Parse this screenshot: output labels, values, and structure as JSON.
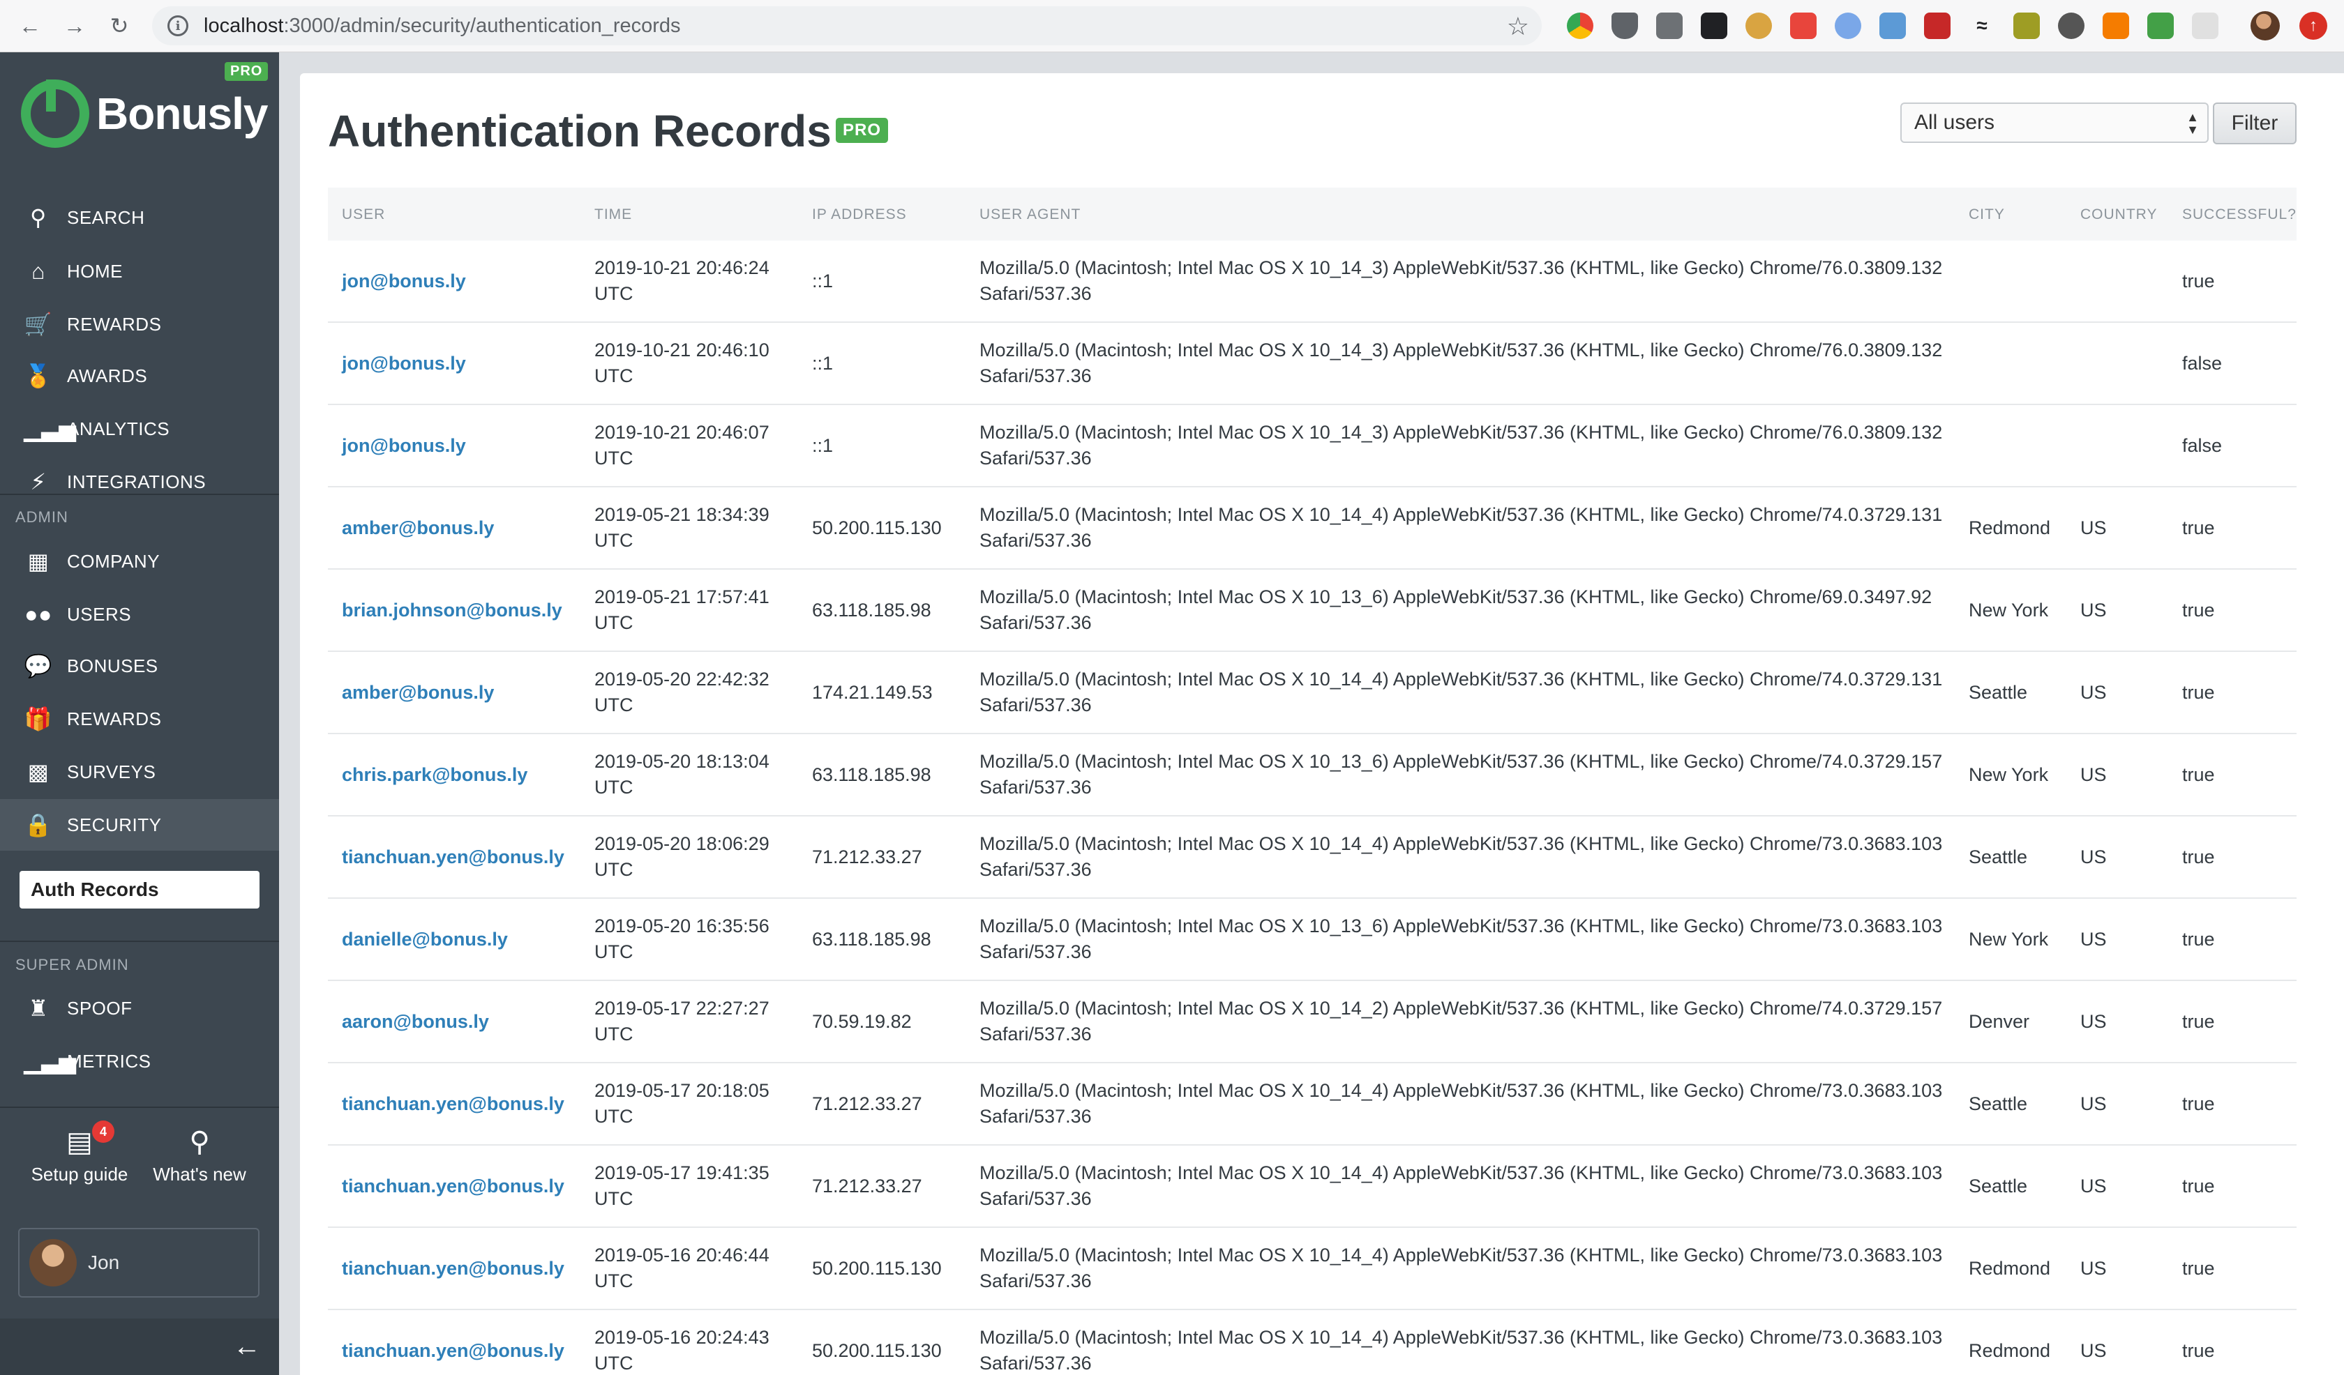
{
  "browser": {
    "url_host": "localhost",
    "url_path": ":3000/admin/security/authentication_records"
  },
  "sidebar": {
    "logo_text": "Bonusly",
    "pro_badge": "PRO",
    "nav": [
      {
        "label": "SEARCH",
        "icon": "search-icon"
      },
      {
        "label": "HOME",
        "icon": "home-icon"
      },
      {
        "label": "REWARDS",
        "icon": "cart-icon"
      },
      {
        "label": "AWARDS",
        "icon": "medal-icon"
      },
      {
        "label": "ANALYTICS",
        "icon": "bar-chart-icon"
      },
      {
        "label": "INTEGRATIONS",
        "icon": "plug-icon"
      }
    ],
    "admin_section": "ADMIN",
    "admin_nav": [
      {
        "label": "COMPANY",
        "icon": "building-icon"
      },
      {
        "label": "USERS",
        "icon": "users-icon"
      },
      {
        "label": "BONUSES",
        "icon": "chat-bubble-icon"
      },
      {
        "label": "REWARDS",
        "icon": "gift-icon"
      },
      {
        "label": "SURVEYS",
        "icon": "survey-chart-icon"
      },
      {
        "label": "SECURITY",
        "icon": "lock-icon"
      }
    ],
    "subnav_active": "Auth Records",
    "super_admin_section": "SUPER ADMIN",
    "super_admin_nav": [
      {
        "label": "SPOOF",
        "icon": "spy-icon"
      },
      {
        "label": "METRICS",
        "icon": "metrics-chart-icon"
      }
    ],
    "setup_guide": {
      "label": "Setup guide",
      "badge": "4"
    },
    "whats_new": {
      "label": "What's new"
    },
    "user_name": "Jon"
  },
  "main": {
    "title": "Authentication Records",
    "pro_badge": "PRO",
    "user_filter": "All users",
    "filter_button": "Filter",
    "columns": [
      "USER",
      "TIME",
      "IP ADDRESS",
      "USER AGENT",
      "CITY",
      "COUNTRY",
      "SUCCESSFUL?"
    ],
    "rows": [
      {
        "user": "jon@bonus.ly",
        "time1": "2019-10-21 20:46:24",
        "time2": "UTC",
        "ip": "::1",
        "ua1": "Mozilla/5.0 (Macintosh; Intel Mac OS X 10_14_3) AppleWebKit/537.36 (KHTML, like Gecko) Chrome/76.0.3809.132",
        "ua2": "Safari/537.36",
        "city": "",
        "country": "",
        "success": "true"
      },
      {
        "user": "jon@bonus.ly",
        "time1": "2019-10-21 20:46:10",
        "time2": "UTC",
        "ip": "::1",
        "ua1": "Mozilla/5.0 (Macintosh; Intel Mac OS X 10_14_3) AppleWebKit/537.36 (KHTML, like Gecko) Chrome/76.0.3809.132",
        "ua2": "Safari/537.36",
        "city": "",
        "country": "",
        "success": "false"
      },
      {
        "user": "jon@bonus.ly",
        "time1": "2019-10-21 20:46:07",
        "time2": "UTC",
        "ip": "::1",
        "ua1": "Mozilla/5.0 (Macintosh; Intel Mac OS X 10_14_3) AppleWebKit/537.36 (KHTML, like Gecko) Chrome/76.0.3809.132",
        "ua2": "Safari/537.36",
        "city": "",
        "country": "",
        "success": "false"
      },
      {
        "user": "amber@bonus.ly",
        "time1": "2019-05-21 18:34:39",
        "time2": "UTC",
        "ip": "50.200.115.130",
        "ua1": "Mozilla/5.0 (Macintosh; Intel Mac OS X 10_14_4) AppleWebKit/537.36 (KHTML, like Gecko) Chrome/74.0.3729.131",
        "ua2": "Safari/537.36",
        "city": "Redmond",
        "country": "US",
        "success": "true"
      },
      {
        "user": "brian.johnson@bonus.ly",
        "time1": "2019-05-21 17:57:41",
        "time2": "UTC",
        "ip": "63.118.185.98",
        "ua1": "Mozilla/5.0 (Macintosh; Intel Mac OS X 10_13_6) AppleWebKit/537.36 (KHTML, like Gecko) Chrome/69.0.3497.92",
        "ua2": "Safari/537.36",
        "city": "New York",
        "country": "US",
        "success": "true"
      },
      {
        "user": "amber@bonus.ly",
        "time1": "2019-05-20 22:42:32",
        "time2": "UTC",
        "ip": "174.21.149.53",
        "ua1": "Mozilla/5.0 (Macintosh; Intel Mac OS X 10_14_4) AppleWebKit/537.36 (KHTML, like Gecko) Chrome/74.0.3729.131",
        "ua2": "Safari/537.36",
        "city": "Seattle",
        "country": "US",
        "success": "true"
      },
      {
        "user": "chris.park@bonus.ly",
        "time1": "2019-05-20 18:13:04",
        "time2": "UTC",
        "ip": "63.118.185.98",
        "ua1": "Mozilla/5.0 (Macintosh; Intel Mac OS X 10_13_6) AppleWebKit/537.36 (KHTML, like Gecko) Chrome/74.0.3729.157",
        "ua2": "Safari/537.36",
        "city": "New York",
        "country": "US",
        "success": "true"
      },
      {
        "user": "tianchuan.yen@bonus.ly",
        "time1": "2019-05-20 18:06:29",
        "time2": "UTC",
        "ip": "71.212.33.27",
        "ua1": "Mozilla/5.0 (Macintosh; Intel Mac OS X 10_14_4) AppleWebKit/537.36 (KHTML, like Gecko) Chrome/73.0.3683.103",
        "ua2": "Safari/537.36",
        "city": "Seattle",
        "country": "US",
        "success": "true"
      },
      {
        "user": "danielle@bonus.ly",
        "time1": "2019-05-20 16:35:56",
        "time2": "UTC",
        "ip": "63.118.185.98",
        "ua1": "Mozilla/5.0 (Macintosh; Intel Mac OS X 10_13_6) AppleWebKit/537.36 (KHTML, like Gecko) Chrome/73.0.3683.103",
        "ua2": "Safari/537.36",
        "city": "New York",
        "country": "US",
        "success": "true"
      },
      {
        "user": "aaron@bonus.ly",
        "time1": "2019-05-17 22:27:27",
        "time2": "UTC",
        "ip": "70.59.19.82",
        "ua1": "Mozilla/5.0 (Macintosh; Intel Mac OS X 10_14_2) AppleWebKit/537.36 (KHTML, like Gecko) Chrome/74.0.3729.157",
        "ua2": "Safari/537.36",
        "city": "Denver",
        "country": "US",
        "success": "true"
      },
      {
        "user": "tianchuan.yen@bonus.ly",
        "time1": "2019-05-17 20:18:05",
        "time2": "UTC",
        "ip": "71.212.33.27",
        "ua1": "Mozilla/5.0 (Macintosh; Intel Mac OS X 10_14_4) AppleWebKit/537.36 (KHTML, like Gecko) Chrome/73.0.3683.103",
        "ua2": "Safari/537.36",
        "city": "Seattle",
        "country": "US",
        "success": "true"
      },
      {
        "user": "tianchuan.yen@bonus.ly",
        "time1": "2019-05-17 19:41:35",
        "time2": "UTC",
        "ip": "71.212.33.27",
        "ua1": "Mozilla/5.0 (Macintosh; Intel Mac OS X 10_14_4) AppleWebKit/537.36 (KHTML, like Gecko) Chrome/73.0.3683.103",
        "ua2": "Safari/537.36",
        "city": "Seattle",
        "country": "US",
        "success": "true"
      },
      {
        "user": "tianchuan.yen@bonus.ly",
        "time1": "2019-05-16 20:46:44",
        "time2": "UTC",
        "ip": "50.200.115.130",
        "ua1": "Mozilla/5.0 (Macintosh; Intel Mac OS X 10_14_4) AppleWebKit/537.36 (KHTML, like Gecko) Chrome/73.0.3683.103",
        "ua2": "Safari/537.36",
        "city": "Redmond",
        "country": "US",
        "success": "true"
      },
      {
        "user": "tianchuan.yen@bonus.ly",
        "time1": "2019-05-16 20:24:43",
        "time2": "UTC",
        "ip": "50.200.115.130",
        "ua1": "Mozilla/5.0 (Macintosh; Intel Mac OS X 10_14_4) AppleWebKit/537.36 (KHTML, like Gecko) Chrome/73.0.3683.103",
        "ua2": "Safari/537.36",
        "city": "Redmond",
        "country": "US",
        "success": "true"
      }
    ]
  },
  "colors": {
    "sidebar_bg": "#3d4750",
    "brand_green": "#3fae5a",
    "link_blue": "#2e7fb8"
  }
}
